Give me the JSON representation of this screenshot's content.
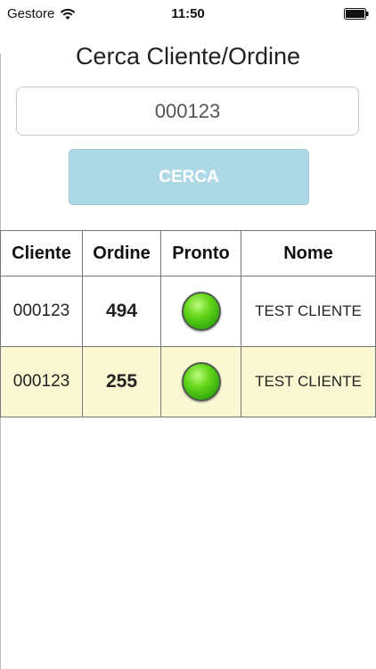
{
  "status_bar": {
    "carrier": "Gestore",
    "time": "11:50"
  },
  "page": {
    "title": "Cerca Cliente/Ordine"
  },
  "search": {
    "value": "000123",
    "button_label": "CERCA",
    "button_color": "#add8e6"
  },
  "table": {
    "headers": [
      "Cliente",
      "Ordine",
      "Pronto",
      "Nome"
    ],
    "rows": [
      {
        "cliente": "000123",
        "ordine": "494",
        "pronto_icon": "green-led-icon",
        "nome": "TEST CLIENTE"
      },
      {
        "cliente": "000123",
        "ordine": "255",
        "pronto_icon": "green-led-icon",
        "nome": "TEST CLIENTE"
      }
    ],
    "alt_row_color": "#f9f8d2"
  }
}
